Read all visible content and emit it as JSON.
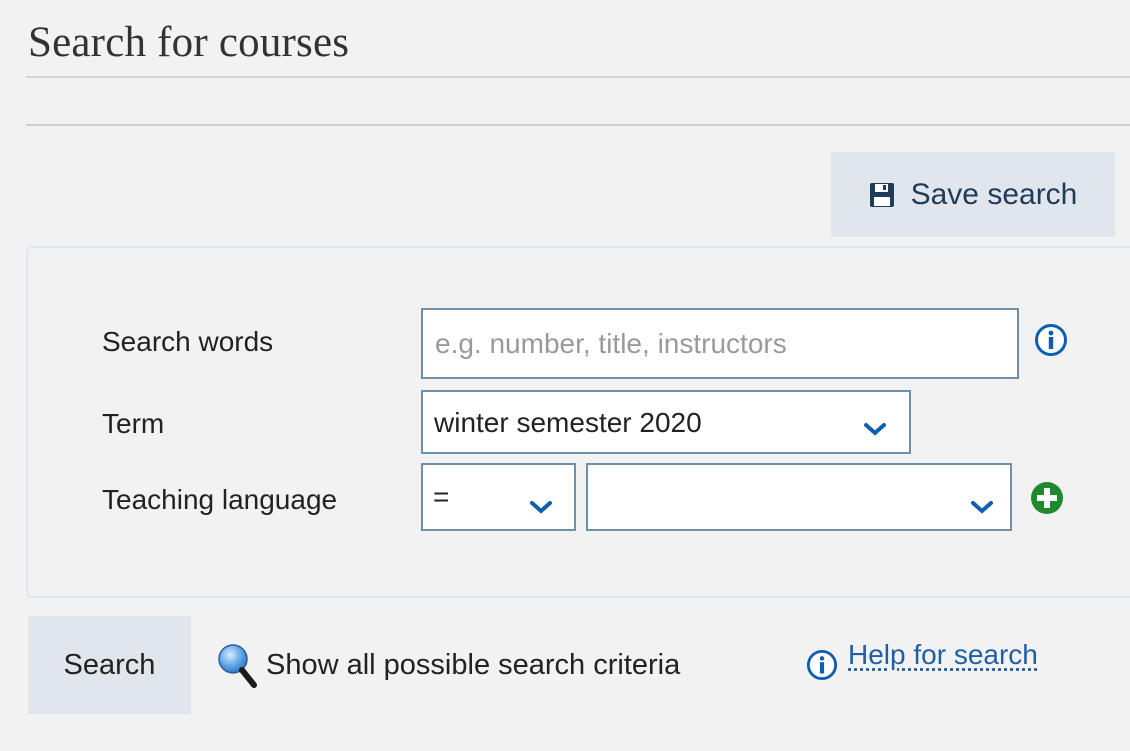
{
  "page": {
    "title": "Search for courses"
  },
  "toolbar": {
    "save_label": "Save search",
    "save_icon": "floppy-disk-icon"
  },
  "form": {
    "search_words": {
      "label": "Search words",
      "value": "",
      "placeholder": "e.g. number, title, instructors",
      "info_icon": "info-icon"
    },
    "term": {
      "label": "Term",
      "selected": "winter semester 2020"
    },
    "teaching_language": {
      "label": "Teaching language",
      "operator": "=",
      "value": "",
      "add_icon": "plus-circle-icon"
    }
  },
  "actions": {
    "search_label": "Search",
    "show_all_label": "Show all possible search criteria",
    "show_all_icon": "magnifier-icon",
    "help_label": "Help for search",
    "help_icon": "info-icon"
  },
  "colors": {
    "accent": "#0a5fb4",
    "button_bg": "#e1e6ec",
    "add_green": "#1e8a2e",
    "link": "#1f5fa6"
  }
}
